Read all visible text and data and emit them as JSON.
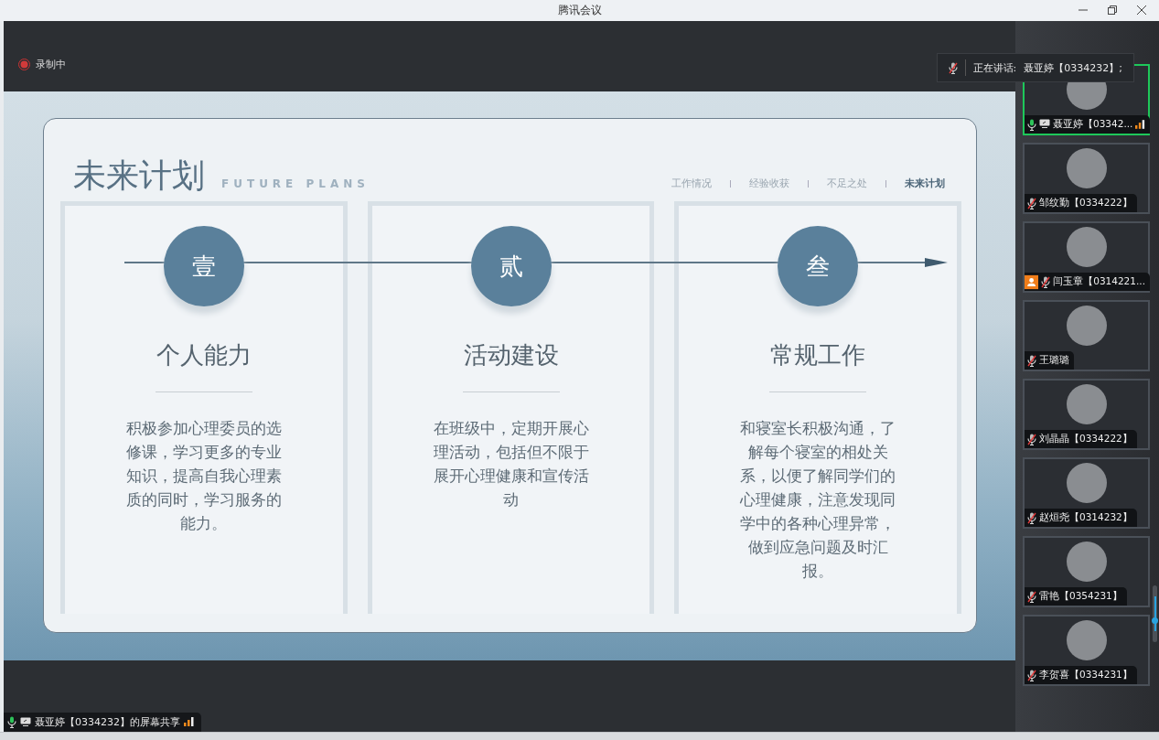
{
  "window": {
    "title": "腾讯会议"
  },
  "recording": {
    "label": "录制中"
  },
  "speaker_toast": {
    "label": "正在讲话:",
    "name": "聂亚婷【0334232】;"
  },
  "slide": {
    "title": "未来计划",
    "subtitle": "FUTURE PLANS",
    "nav": [
      {
        "label": "工作情况",
        "selected": false
      },
      {
        "label": "经验收获",
        "selected": false
      },
      {
        "label": "不足之处",
        "selected": false
      },
      {
        "label": "未来计划",
        "selected": true
      }
    ],
    "columns": [
      {
        "number": "壹",
        "heading": "个人能力",
        "body": "积极参加心理委员的选修课，学习更多的专业知识，提高自我心理素质的同时，学习服务的能力。"
      },
      {
        "number": "贰",
        "heading": "活动建设",
        "body": "在班级中，定期开展心理活动，包括但不限于展开心理健康和宣传活动"
      },
      {
        "number": "叁",
        "heading": "常规工作",
        "body": "和寝室长积极沟通，了解每个寝室的相处关系，以便了解同学们的心理健康，注意发现同学中的各种心理异常，做到应急问题及时汇报。"
      }
    ]
  },
  "participants": [
    {
      "name": "聂亚婷【03342...",
      "muted": false,
      "sharing": true,
      "speaking": true,
      "badge": false
    },
    {
      "name": "邹纹勤【0334222】",
      "muted": true,
      "sharing": false,
      "speaking": false,
      "badge": false
    },
    {
      "name": "闫玉章【0314221...",
      "muted": true,
      "sharing": false,
      "speaking": false,
      "badge": true
    },
    {
      "name": "王璐璐",
      "muted": true,
      "sharing": false,
      "speaking": false,
      "badge": false
    },
    {
      "name": "刘晶晶【0334222】",
      "muted": true,
      "sharing": false,
      "speaking": false,
      "badge": false
    },
    {
      "name": "赵烜尧【0314232】",
      "muted": true,
      "sharing": false,
      "speaking": false,
      "badge": false
    },
    {
      "name": "雷艳【0354231】",
      "muted": true,
      "sharing": false,
      "speaking": false,
      "badge": false
    },
    {
      "name": "李贺喜【0334231】",
      "muted": true,
      "sharing": false,
      "speaking": false,
      "badge": false
    }
  ],
  "share_bar": {
    "label": "聂亚婷【0334232】的屏幕共享",
    "muted": false
  }
}
